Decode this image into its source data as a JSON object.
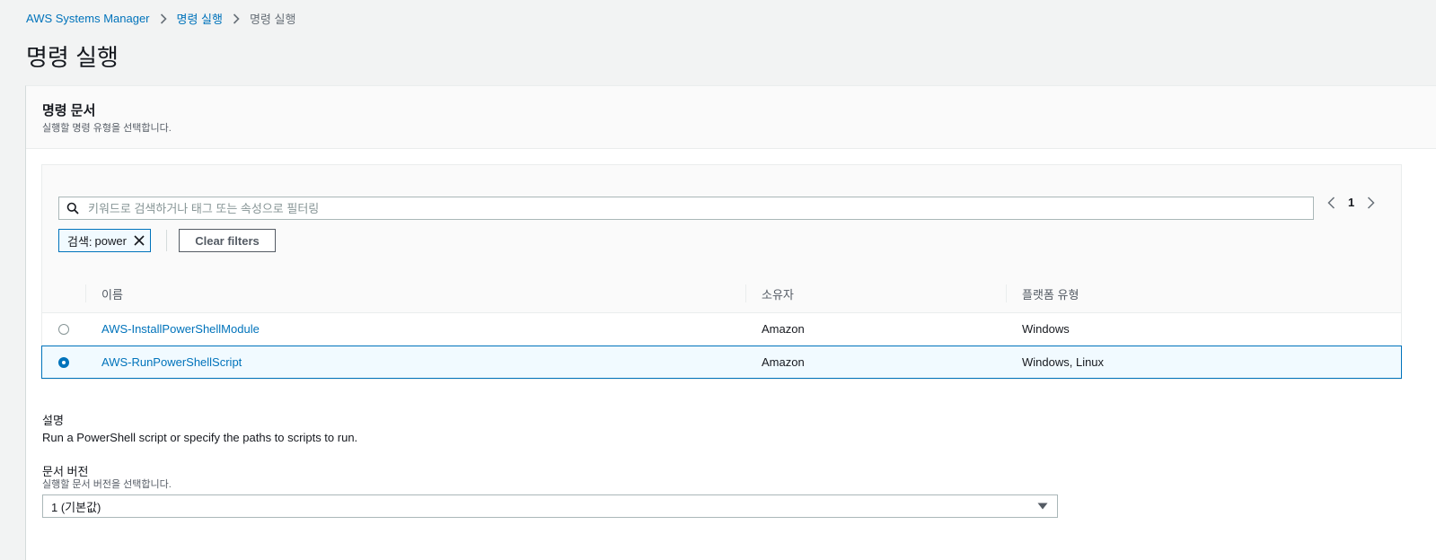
{
  "breadcrumb": {
    "items": [
      "AWS Systems Manager",
      "명령 실행"
    ],
    "current": "명령 실행"
  },
  "page_title": "명령 실행",
  "document_panel": {
    "title": "명령 문서",
    "subtitle": "실행할 명령 유형을 선택합니다."
  },
  "search": {
    "placeholder": "키워드로 검색하거나 태그 또는 속성으로 필터링",
    "value": "",
    "icon": "search-icon"
  },
  "pagination": {
    "current_page": "1",
    "prev_icon": "chevron-left-icon",
    "next_icon": "chevron-right-icon"
  },
  "filter_token": {
    "label": "검색:",
    "value": "power",
    "close_icon": "close-icon"
  },
  "clear_filters_label": "Clear filters",
  "table": {
    "columns": [
      "이름",
      "소유자",
      "플랫폼 유형"
    ],
    "rows": [
      {
        "name": "AWS-InstallPowerShellModule",
        "owner": "Amazon",
        "platform": "Windows",
        "selected": false
      },
      {
        "name": "AWS-RunPowerShellScript",
        "owner": "Amazon",
        "platform": "Windows, Linux",
        "selected": true
      }
    ]
  },
  "description": {
    "label": "설명",
    "text": "Run a PowerShell script or specify the paths to scripts to run."
  },
  "document_version": {
    "label": "문서 버전",
    "subtitle": "실행할 문서 버전을 선택합니다.",
    "selected_value": "1 (기본값)",
    "caret_icon": "caret-down-icon"
  },
  "colors": {
    "link": "#0073bb",
    "selected_row_bg": "#f1faff",
    "page_bg": "#f2f3f3"
  }
}
